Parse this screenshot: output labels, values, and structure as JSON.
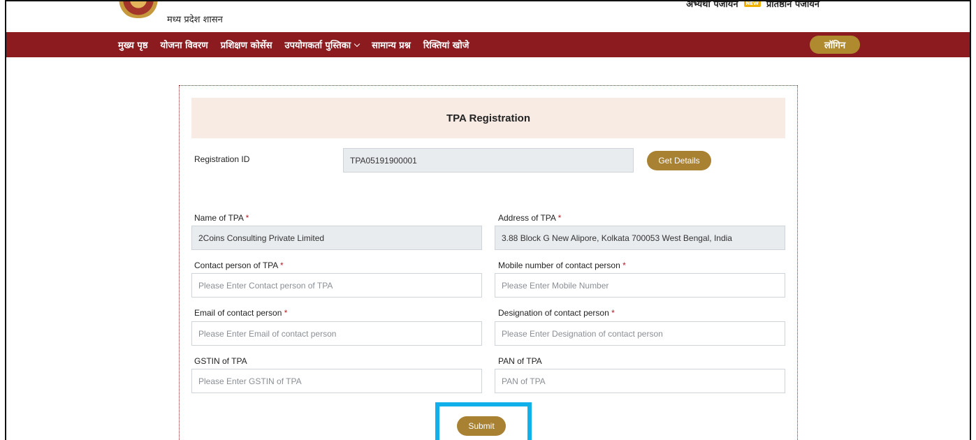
{
  "header": {
    "gov_name": "मध्य प्रदेश शासन",
    "candidate_registration": "अभ्यर्थी पंजीयन",
    "new_badge": "NEW",
    "institute_registration": "प्रतिष्ठान पंजीयन"
  },
  "nav": {
    "items": [
      {
        "label": "मुख्य पृष्ठ"
      },
      {
        "label": "योजना विवरण"
      },
      {
        "label": "प्रशिक्षण कोर्सेस"
      },
      {
        "label": "उपयोगकर्ता पुस्तिका"
      },
      {
        "label": "सामान्य प्रश्न"
      },
      {
        "label": "रिक्तियां खोजे"
      }
    ],
    "login": "लॉगिन"
  },
  "form": {
    "title": "TPA Registration",
    "registration_id": {
      "label": "Registration ID",
      "value": "TPA05191900001"
    },
    "get_details": "Get Details",
    "name": {
      "label": "Name of TPA",
      "req": "*",
      "value": "2Coins Consulting Private Limited"
    },
    "address": {
      "label": "Address of TPA",
      "req": "*",
      "value": "3.88 Block G New Alipore, Kolkata 700053 West Bengal, India"
    },
    "contact_person": {
      "label": "Contact person of TPA",
      "req": "*",
      "placeholder": "Please Enter Contact person of TPA"
    },
    "mobile": {
      "label": "Mobile number of contact person",
      "req": "*",
      "placeholder": "Please Enter Mobile Number"
    },
    "email": {
      "label": "Email of contact person",
      "req": "*",
      "placeholder": "Please Enter Email of contact person"
    },
    "designation": {
      "label": "Designation of contact person",
      "req": "*",
      "placeholder": "Please Enter Designation of contact person"
    },
    "gstin": {
      "label": "GSTIN of TPA",
      "placeholder": "Please Enter GSTIN of TPA"
    },
    "pan": {
      "label": "PAN of TPA",
      "placeholder": "PAN of TPA"
    },
    "submit": "Submit"
  },
  "colors": {
    "nav_bg": "#8b1b1f",
    "button_gold": "#a88132",
    "header_bg": "#f7ebe4",
    "highlight": "#11b0ea"
  }
}
